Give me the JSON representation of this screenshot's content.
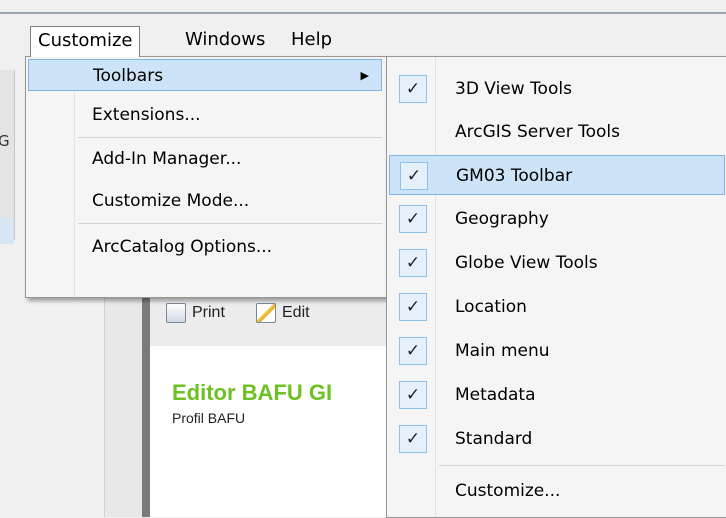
{
  "menubar": {
    "items": [
      {
        "label": "Customize",
        "open": true
      },
      {
        "label": "Windows"
      },
      {
        "label": "Help"
      }
    ]
  },
  "customize_menu": {
    "items": [
      {
        "label": "Toolbars",
        "has_submenu": true,
        "highlighted": true
      },
      {
        "label": "Extensions..."
      },
      {
        "label": "Add-In Manager..."
      },
      {
        "label": "Customize Mode..."
      },
      {
        "label": "ArcCatalog Options..."
      }
    ]
  },
  "toolbars_submenu": {
    "items": [
      {
        "label": "3D View Tools",
        "checked": true
      },
      {
        "label": "ArcGIS Server Tools",
        "checked": false
      },
      {
        "label": "GM03 Toolbar",
        "checked": true,
        "highlighted": true
      },
      {
        "label": "Geography",
        "checked": true
      },
      {
        "label": "Globe View Tools",
        "checked": true
      },
      {
        "label": "Location",
        "checked": true
      },
      {
        "label": "Main menu",
        "checked": true
      },
      {
        "label": "Metadata",
        "checked": true
      },
      {
        "label": "Standard",
        "checked": true
      },
      {
        "label": "Customize...",
        "checked": false
      }
    ]
  },
  "document_panel": {
    "print_label": "Print",
    "edit_label": "Edit",
    "title": "Editor BAFU GI",
    "subtitle": "Profil BAFU"
  },
  "left_fragments": [
    "G"
  ],
  "icons": {
    "check": "check-icon",
    "submenu_arrow": "arrow-right-icon"
  },
  "colors": {
    "highlight": "#cde3f7",
    "highlight_border": "#84b3e3",
    "title_green": "#6ec023"
  }
}
